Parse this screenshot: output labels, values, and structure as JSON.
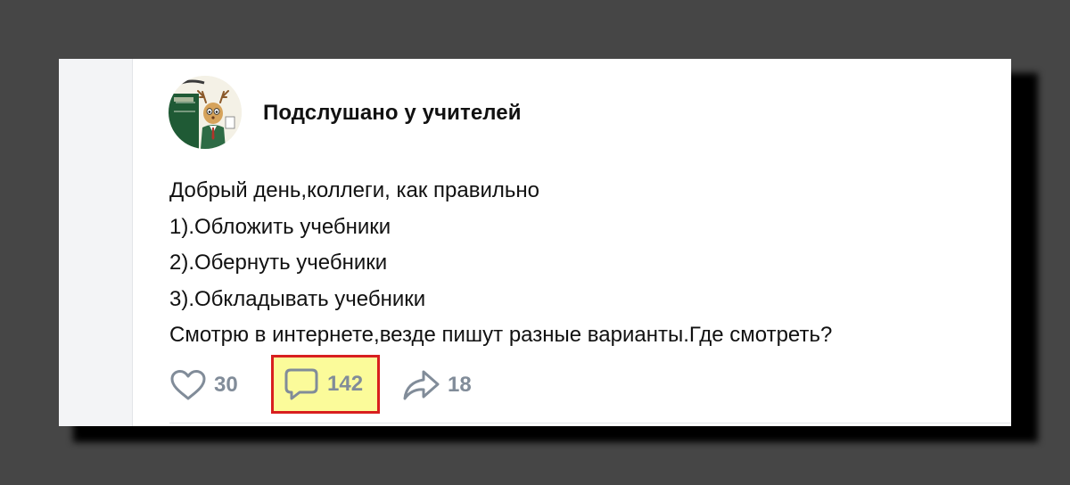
{
  "post": {
    "group_name": "Подслушано у учителей",
    "avatar_icon": "deer-teacher-avatar",
    "text_lines": [
      "Добрый день,коллеги, как правильно",
      "1).Обложить учебники",
      "2).Обернуть учебники",
      "3).Обкладывать учебники",
      "Смотрю в интернете,везде пишут разные варианты.Где смотреть?"
    ]
  },
  "actions": {
    "likes": {
      "icon": "heart-icon",
      "count": "30"
    },
    "comments": {
      "icon": "comment-icon",
      "count": "142",
      "highlighted": true
    },
    "shares": {
      "icon": "share-arrow-icon",
      "count": "18"
    }
  },
  "colors": {
    "background": "#464646",
    "card": "#ffffff",
    "icon_gray": "#818c99",
    "highlight_fill": "#fbfb9a",
    "highlight_border": "#d81f1f"
  }
}
